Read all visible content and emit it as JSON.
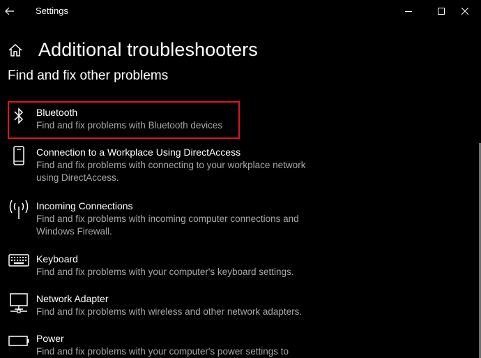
{
  "window": {
    "title": "Settings"
  },
  "page": {
    "title": "Additional troubleshooters",
    "section_title": "Find and fix other problems"
  },
  "troubleshooters": [
    {
      "name": "Bluetooth",
      "description": "Find and fix problems with Bluetooth devices",
      "icon": "bluetooth-icon",
      "highlighted": true
    },
    {
      "name": "Connection to a Workplace Using DirectAccess",
      "description": "Find and fix problems with connecting to your workplace network using DirectAccess.",
      "icon": "phone-icon",
      "highlighted": false
    },
    {
      "name": "Incoming Connections",
      "description": "Find and fix problems with incoming computer connections and Windows Firewall.",
      "icon": "wireless-signal-icon",
      "highlighted": false
    },
    {
      "name": "Keyboard",
      "description": "Find and fix problems with your computer's keyboard settings.",
      "icon": "keyboard-icon",
      "highlighted": false
    },
    {
      "name": "Network Adapter",
      "description": "Find and fix problems with wireless and other network adapters.",
      "icon": "network-monitor-icon",
      "highlighted": false
    },
    {
      "name": "Power",
      "description": "Find and fix problems with your computer's power settings to",
      "icon": "battery-icon",
      "highlighted": false
    }
  ],
  "colors": {
    "background": "#000000",
    "text_primary": "#ffffff",
    "text_secondary": "#a8a8a8",
    "highlight_border": "#e0141e"
  }
}
